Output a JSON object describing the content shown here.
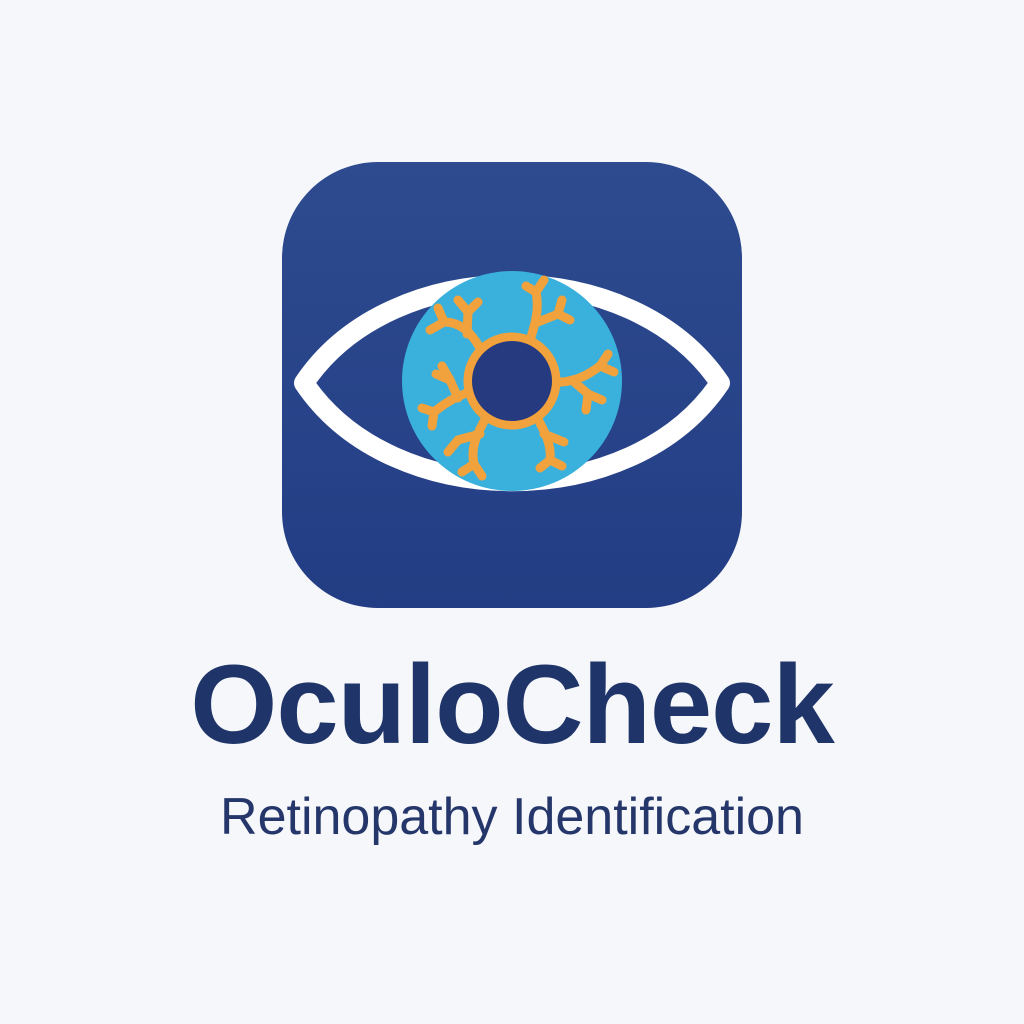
{
  "logo": {
    "icon": "eye-retina-icon",
    "colors": {
      "tile": "#233d84",
      "eye_outline": "#ffffff",
      "iris": "#3ab0dc",
      "vessels": "#f2a23c",
      "pupil": "#263a80",
      "page_background": "#f6f7fa"
    }
  },
  "brand": {
    "name": "OculoCheck",
    "tagline": "Retinopathy Identification"
  }
}
